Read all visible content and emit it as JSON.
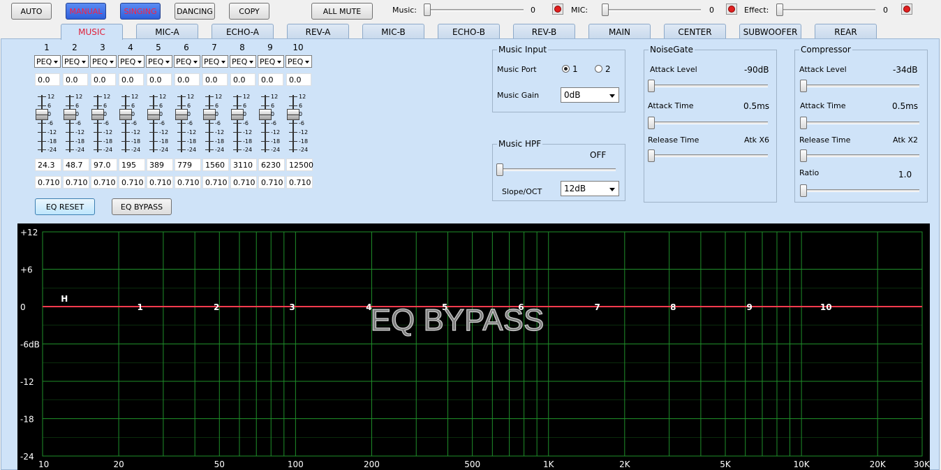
{
  "toolbar": {
    "auto": "AUTO",
    "manual": "MANUAL",
    "singing": "SINGING",
    "dancing": "DANCING",
    "copy": "COPY",
    "all_mute": "ALL MUTE"
  },
  "levels": [
    {
      "label": "Music:",
      "value": "0"
    },
    {
      "label": "MIC:",
      "value": "0"
    },
    {
      "label": "Effect:",
      "value": "0"
    }
  ],
  "tabs": [
    "MUSIC",
    "MIC-A",
    "ECHO-A",
    "REV-A",
    "MIC-B",
    "ECHO-B",
    "REV-B",
    "MAIN",
    "CENTER",
    "SUBWOOFER",
    "REAR"
  ],
  "active_tab": "MUSIC",
  "eq": {
    "channels": [
      {
        "num": "1",
        "type": "PEQ",
        "gain": "0.0",
        "freq": "24.3",
        "q": "0.710"
      },
      {
        "num": "2",
        "type": "PEQ",
        "gain": "0.0",
        "freq": "48.7",
        "q": "0.710"
      },
      {
        "num": "3",
        "type": "PEQ",
        "gain": "0.0",
        "freq": "97.0",
        "q": "0.710"
      },
      {
        "num": "4",
        "type": "PEQ",
        "gain": "0.0",
        "freq": "195",
        "q": "0.710"
      },
      {
        "num": "5",
        "type": "PEQ",
        "gain": "0.0",
        "freq": "389",
        "q": "0.710"
      },
      {
        "num": "6",
        "type": "PEQ",
        "gain": "0.0",
        "freq": "779",
        "q": "0.710"
      },
      {
        "num": "7",
        "type": "PEQ",
        "gain": "0.0",
        "freq": "1560",
        "q": "0.710"
      },
      {
        "num": "8",
        "type": "PEQ",
        "gain": "0.0",
        "freq": "3110",
        "q": "0.710"
      },
      {
        "num": "9",
        "type": "PEQ",
        "gain": "0.0",
        "freq": "6230",
        "q": "0.710"
      },
      {
        "num": "10",
        "type": "PEQ",
        "gain": "0.0",
        "freq": "12500",
        "q": "0.710"
      }
    ],
    "fader_scale": [
      "12",
      "6",
      "0",
      "-6",
      "-12",
      "-18",
      "-24"
    ],
    "reset_label": "EQ RESET",
    "bypass_label": "EQ BYPASS"
  },
  "music_input": {
    "title": "Music Input",
    "port_label": "Music Port",
    "port_options": [
      "1",
      "2"
    ],
    "port_selected": "1",
    "gain_label": "Music Gain",
    "gain_value": "0dB"
  },
  "music_hpf": {
    "title": "Music HPF",
    "value": "OFF",
    "slope_label": "Slope/OCT",
    "slope_value": "12dB"
  },
  "noisegate": {
    "title": "NoiseGate",
    "attack_level_label": "Attack Level",
    "attack_level_value": "-90dB",
    "attack_time_label": "Attack Time",
    "attack_time_value": "0.5ms",
    "release_time_label": "Release Time",
    "release_time_value": "Atk X6"
  },
  "compressor": {
    "title": "Compressor",
    "attack_level_label": "Attack Level",
    "attack_level_value": "-34dB",
    "attack_time_label": "Attack Time",
    "attack_time_value": "0.5ms",
    "release_time_label": "Release Time",
    "release_time_value": "Atk X2",
    "ratio_label": "Ratio",
    "ratio_value": "1.0"
  },
  "graph": {
    "overlay_text": "EQ BYPASS",
    "y_labels": [
      "+12",
      "+6",
      "0",
      "-6dB",
      "-12",
      "-18",
      "-24"
    ],
    "x_labels": [
      "10",
      "20",
      "50",
      "100",
      "200",
      "500",
      "1K",
      "2K",
      "5K",
      "10K",
      "20K",
      "30K"
    ],
    "band_markers": [
      "H",
      "1",
      "2",
      "3",
      "4",
      "5",
      "6",
      "7",
      "8",
      "9",
      "10"
    ],
    "colors": {
      "grid": "#1f8f2a",
      "curve": "#ff3b4e",
      "background": "#000000"
    }
  }
}
